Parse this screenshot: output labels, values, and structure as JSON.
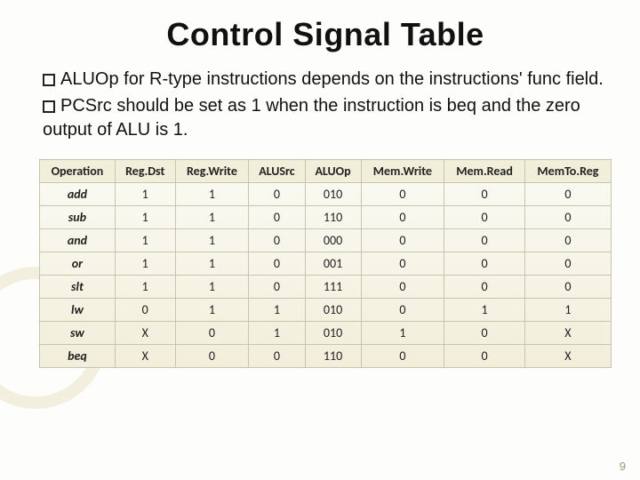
{
  "title": "Control Signal Table",
  "bullets": [
    {
      "lead": "ALUOp",
      "rest": " for R-type instructions depends on the instructions' func field."
    },
    {
      "lead": "PCSrc",
      "rest": " should be set as 1 when the instruction is beq and the zero output of ALU is 1."
    }
  ],
  "table": {
    "headers": [
      "Operation",
      "Reg.Dst",
      "Reg.Write",
      "ALUSrc",
      "ALUOp",
      "Mem.Write",
      "Mem.Read",
      "MemTo.Reg"
    ],
    "rows": [
      {
        "op": "add",
        "cells": [
          "1",
          "1",
          "0",
          "010",
          "0",
          "0",
          "0"
        ],
        "aluop_color": "red"
      },
      {
        "op": "sub",
        "cells": [
          "1",
          "1",
          "0",
          "110",
          "0",
          "0",
          "0"
        ],
        "aluop_color": "red"
      },
      {
        "op": "and",
        "cells": [
          "1",
          "1",
          "0",
          "000",
          "0",
          "0",
          "0"
        ],
        "aluop_color": "red"
      },
      {
        "op": "or",
        "cells": [
          "1",
          "1",
          "0",
          "001",
          "0",
          "0",
          "0"
        ],
        "aluop_color": "red"
      },
      {
        "op": "slt",
        "cells": [
          "1",
          "1",
          "0",
          "111",
          "0",
          "0",
          "0"
        ],
        "aluop_color": "red"
      },
      {
        "op": "lw",
        "cells": [
          "0",
          "1",
          "1",
          "010",
          "0",
          "1",
          "1"
        ],
        "aluop_color": ""
      },
      {
        "op": "sw",
        "cells": [
          "X",
          "0",
          "1",
          "010",
          "1",
          "0",
          "X"
        ],
        "aluop_color": "",
        "green_cols": [
          0,
          1,
          6
        ]
      },
      {
        "op": "beq",
        "cells": [
          "X",
          "0",
          "0",
          "110",
          "0",
          "0",
          "X"
        ],
        "aluop_color": "",
        "green_cols": [
          0,
          1,
          6
        ]
      }
    ]
  },
  "page_number": "9",
  "chart_data": {
    "type": "table",
    "title": "Control Signal Table",
    "columns": [
      "Operation",
      "Reg.Dst",
      "Reg.Write",
      "ALUSrc",
      "ALUOp",
      "Mem.Write",
      "Mem.Read",
      "MemTo.Reg"
    ],
    "rows": [
      [
        "add",
        "1",
        "1",
        "0",
        "010",
        "0",
        "0",
        "0"
      ],
      [
        "sub",
        "1",
        "1",
        "0",
        "110",
        "0",
        "0",
        "0"
      ],
      [
        "and",
        "1",
        "1",
        "0",
        "000",
        "0",
        "0",
        "0"
      ],
      [
        "or",
        "1",
        "1",
        "0",
        "001",
        "0",
        "0",
        "0"
      ],
      [
        "slt",
        "1",
        "1",
        "0",
        "111",
        "0",
        "0",
        "0"
      ],
      [
        "lw",
        "0",
        "1",
        "1",
        "010",
        "0",
        "1",
        "1"
      ],
      [
        "sw",
        "X",
        "0",
        "1",
        "010",
        "1",
        "0",
        "X"
      ],
      [
        "beq",
        "X",
        "0",
        "0",
        "110",
        "0",
        "0",
        "X"
      ]
    ]
  }
}
